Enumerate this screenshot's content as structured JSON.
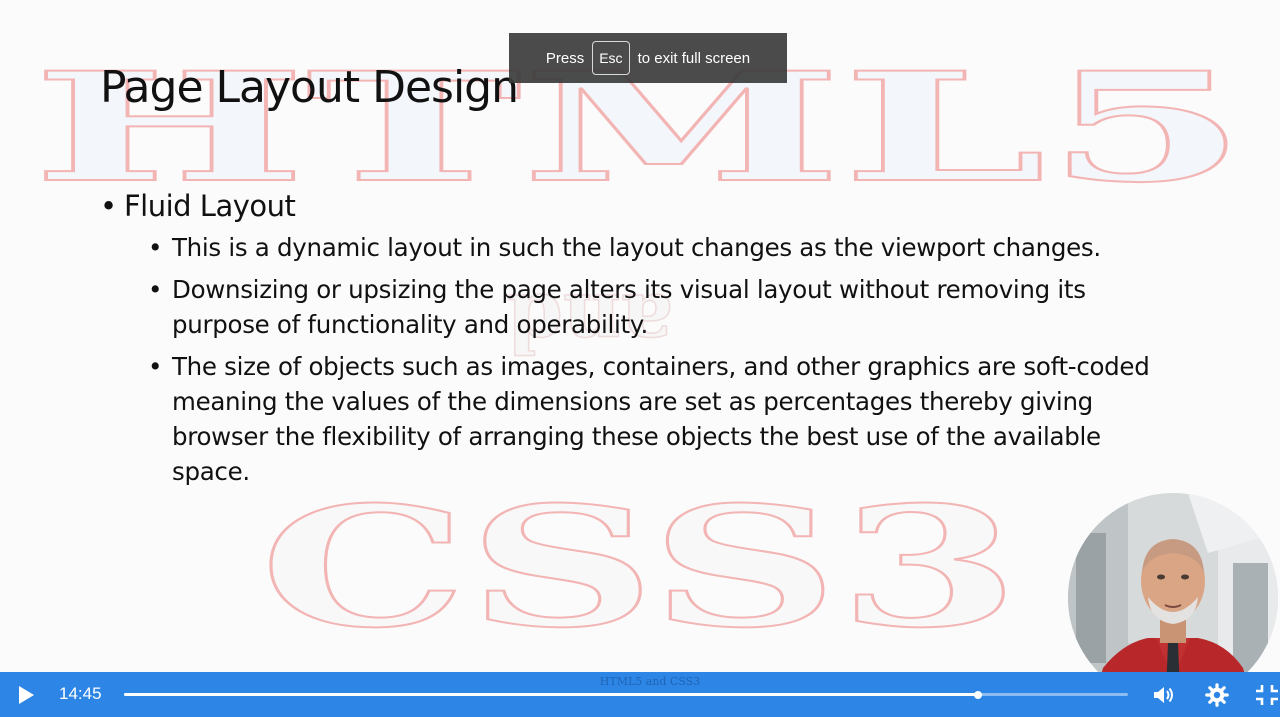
{
  "slide": {
    "title": "Page Layout Design",
    "bullet": "Fluid Layout",
    "sub_bullets": [
      "This is a dynamic layout in such the layout changes as the viewport changes.",
      "Downsizing or upsizing the page alters its visual layout without removing its purpose of functionality and operability.",
      "The size of objects such as images, containers, and other graphics are soft-coded meaning the values of the dimensions are set as percentages thereby giving browser the flexibility of arranging these objects the best use of the available space."
    ],
    "watermark_top": "HTML5",
    "watermark_middle": "and",
    "watermark_bottom": "CSS3",
    "footer": "HTML5 and CSS3"
  },
  "fullscreen_notice": {
    "before": "Press",
    "key": "Esc",
    "after": "to exit full screen"
  },
  "player": {
    "current_time": "14:45",
    "progress_fraction": 0.851,
    "icons": {
      "play": "play-icon",
      "volume": "volume-icon",
      "settings": "gear-icon",
      "fullscreen": "fullscreen-exit-icon"
    },
    "accent_color": "#2d86e6"
  }
}
